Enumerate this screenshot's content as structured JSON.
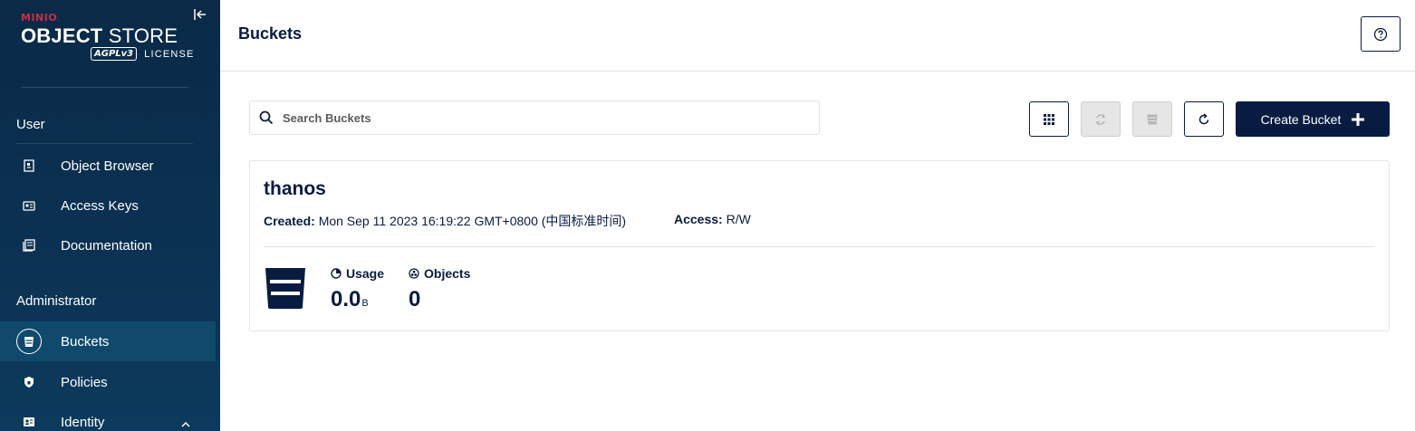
{
  "brand": {
    "minio": "MINIO",
    "product_bold": "OBJECT",
    "product_rest": "STORE",
    "agpl": "AGPLv3",
    "license": "LICENSE"
  },
  "sidebar": {
    "sections": [
      {
        "title": "User",
        "items": [
          {
            "label": "Object Browser",
            "icon": "object-browser-icon"
          },
          {
            "label": "Access Keys",
            "icon": "access-keys-icon"
          },
          {
            "label": "Documentation",
            "icon": "documentation-icon"
          }
        ]
      },
      {
        "title": "Administrator",
        "items": [
          {
            "label": "Buckets",
            "icon": "bucket-icon",
            "active": true
          },
          {
            "label": "Policies",
            "icon": "policies-icon"
          },
          {
            "label": "Identity",
            "icon": "identity-icon",
            "expanded": true
          }
        ]
      }
    ]
  },
  "header": {
    "title": "Buckets"
  },
  "toolbar": {
    "search_placeholder": "Search Buckets",
    "create_label": "Create Bucket",
    "buttons": [
      "grid-view-icon",
      "replication-icon",
      "lifecycle-icon",
      "refresh-icon"
    ]
  },
  "buckets": [
    {
      "name": "thanos",
      "created_label": "Created:",
      "created": "Mon Sep 11 2023 16:19:22 GMT+0800 (中国标准时间)",
      "access_label": "Access:",
      "access": "R/W",
      "usage_label": "Usage",
      "usage_value": "0.0",
      "usage_unit": "B",
      "objects_label": "Objects",
      "objects_value": "0"
    }
  ],
  "colors": {
    "sidebar": "#0a2a47",
    "active_item": "#0f4a6d",
    "primary": "#081c42",
    "brand_red": "#c72e49"
  }
}
